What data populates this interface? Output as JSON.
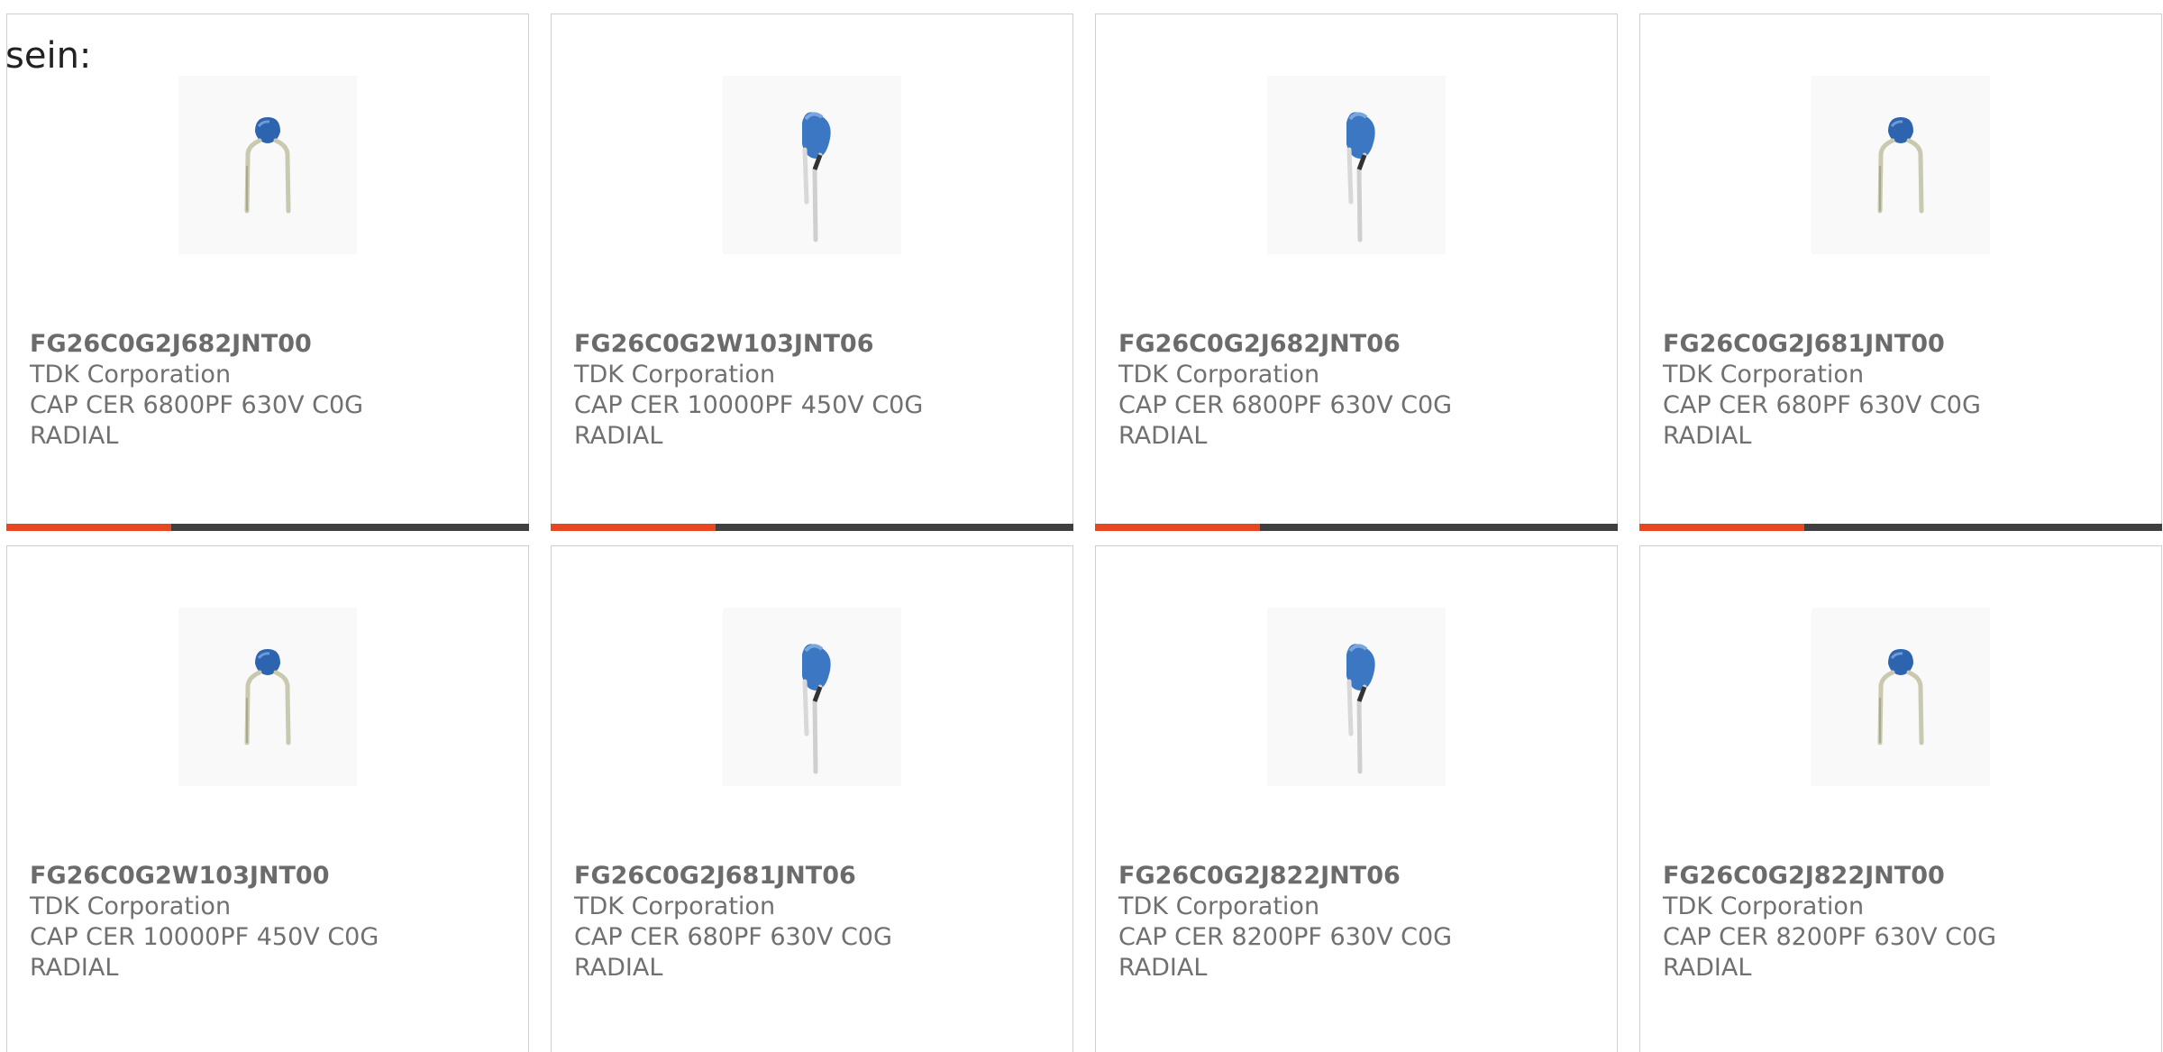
{
  "intro_text": "sein:",
  "colors": {
    "accent": "#e8461e",
    "bar_track": "#3f3f3f",
    "capacitor_blue": "#2d64b0"
  },
  "products": [
    {
      "part": "FG26C0G2J682JNT00",
      "maker": "TDK Corporation",
      "desc": "CAP CER 6800PF 630V C0G",
      "pkg": "RADIAL",
      "image": "small-disc-capacitor-icon"
    },
    {
      "part": "FG26C0G2W103JNT06",
      "maker": "TDK Corporation",
      "desc": "CAP CER 10000PF 450V C0G",
      "pkg": "RADIAL",
      "image": "tilted-disc-capacitor-icon"
    },
    {
      "part": "FG26C0G2J682JNT06",
      "maker": "TDK Corporation",
      "desc": "CAP CER 6800PF 630V C0G",
      "pkg": "RADIAL",
      "image": "tilted-disc-capacitor-icon"
    },
    {
      "part": "FG26C0G2J681JNT00",
      "maker": "TDK Corporation",
      "desc": "CAP CER 680PF 630V C0G",
      "pkg": "RADIAL",
      "image": "small-disc-capacitor-icon"
    },
    {
      "part": "FG26C0G2W103JNT00",
      "maker": "TDK Corporation",
      "desc": "CAP CER 10000PF 450V C0G",
      "pkg": "RADIAL",
      "image": "small-disc-capacitor-icon"
    },
    {
      "part": "FG26C0G2J681JNT06",
      "maker": "TDK Corporation",
      "desc": "CAP CER 680PF 630V C0G",
      "pkg": "RADIAL",
      "image": "tilted-disc-capacitor-icon"
    },
    {
      "part": "FG26C0G2J822JNT06",
      "maker": "TDK Corporation",
      "desc": "CAP CER 8200PF 630V C0G",
      "pkg": "RADIAL",
      "image": "tilted-disc-capacitor-icon"
    },
    {
      "part": "FG26C0G2J822JNT00",
      "maker": "TDK Corporation",
      "desc": "CAP CER 8200PF 630V C0G",
      "pkg": "RADIAL",
      "image": "small-disc-capacitor-icon"
    }
  ]
}
